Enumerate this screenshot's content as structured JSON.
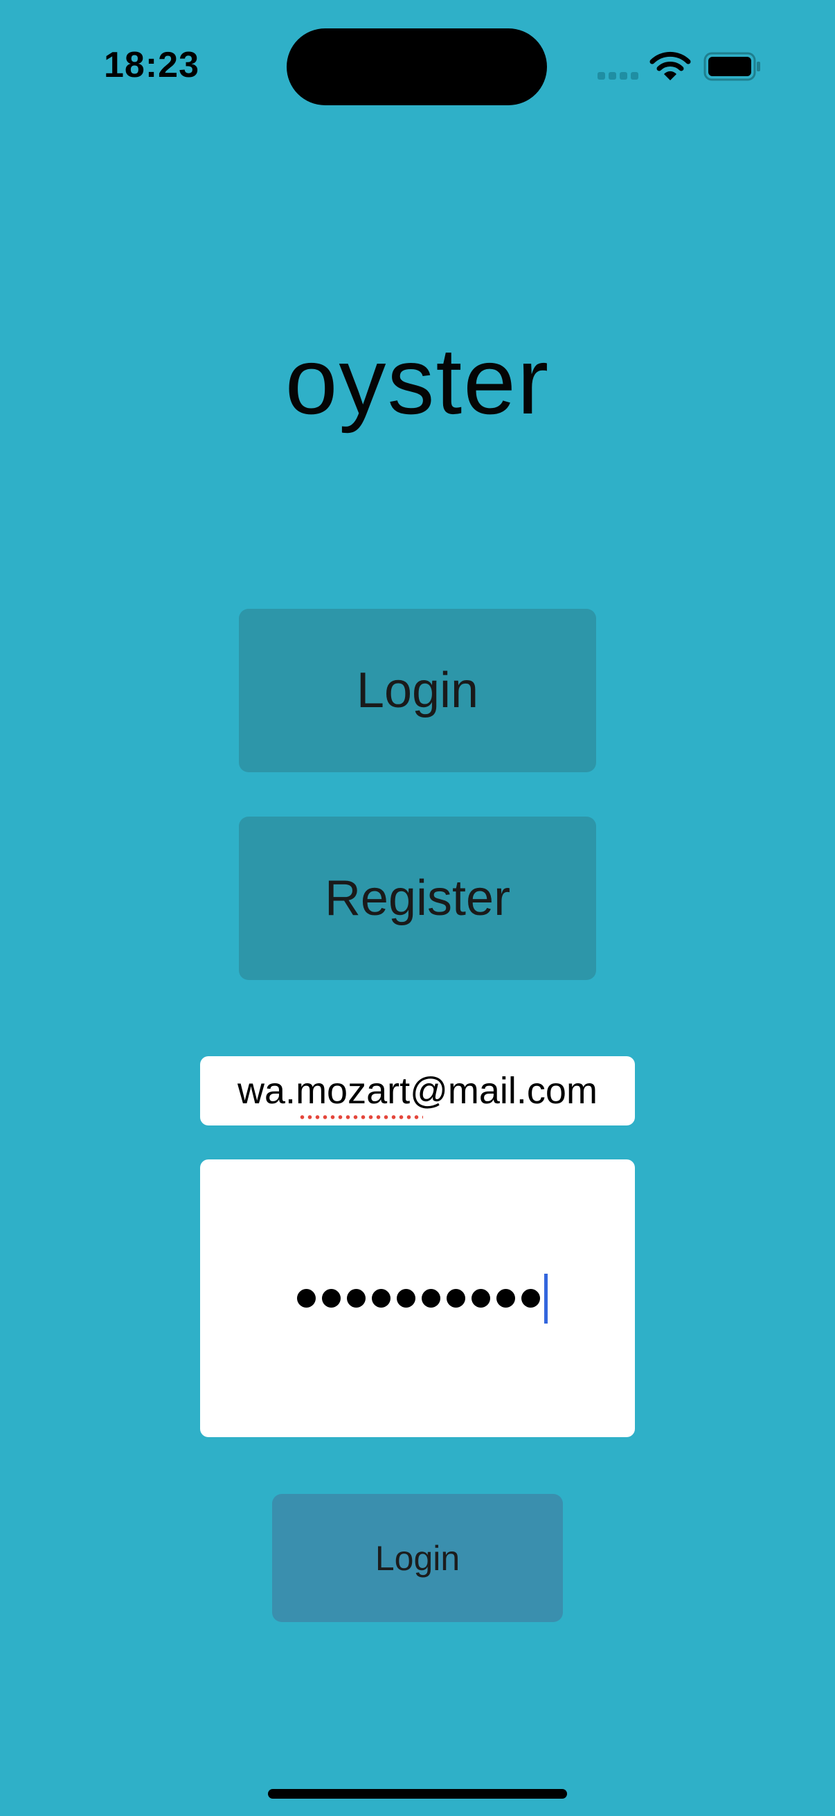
{
  "status_bar": {
    "time": "18:23",
    "icons": [
      "cellular-signal-icon",
      "wifi-icon",
      "battery-icon"
    ]
  },
  "app": {
    "title": "oyster"
  },
  "buttons": {
    "login_top": "Login",
    "register": "Register",
    "submit": "Login"
  },
  "form": {
    "email_value": "wa.mozart@mail.com",
    "password_dot_count": 10
  },
  "colors": {
    "background": "#2fb0c8",
    "button": "#2d96a9",
    "submit_button": "#3a8fae",
    "field": "#ffffff",
    "caret": "#3366dd",
    "spellcheck": "#e4453a"
  }
}
